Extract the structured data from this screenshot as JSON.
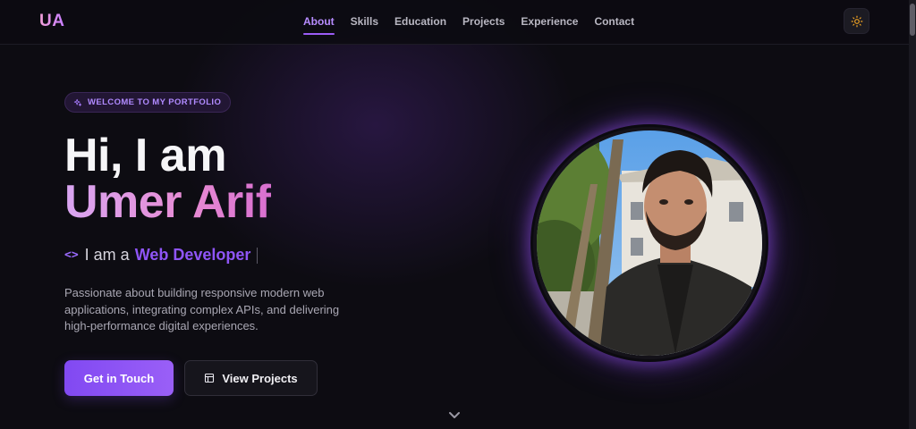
{
  "header": {
    "logo": "UA",
    "nav": [
      "About",
      "Skills",
      "Education",
      "Projects",
      "Experience",
      "Contact"
    ],
    "active_nav": "About",
    "theme_icon": "sun-icon"
  },
  "hero": {
    "badge": "WELCOME TO MY PORTFOLIO",
    "greeting": "Hi, I am",
    "name": "Umer Arif",
    "role_prefix": "I am a",
    "role_title": "Web Developer",
    "description": "Passionate about building responsive modern web applications, integrating complex APIs, and delivering high-performance digital experiences.",
    "primary_button": "Get in Touch",
    "secondary_button": "View Projects"
  },
  "colors": {
    "background": "#0d0c12",
    "accent": "#8f55f7",
    "name_gradient_start": "#d9a6f2",
    "name_gradient_end": "#d86fd0"
  }
}
